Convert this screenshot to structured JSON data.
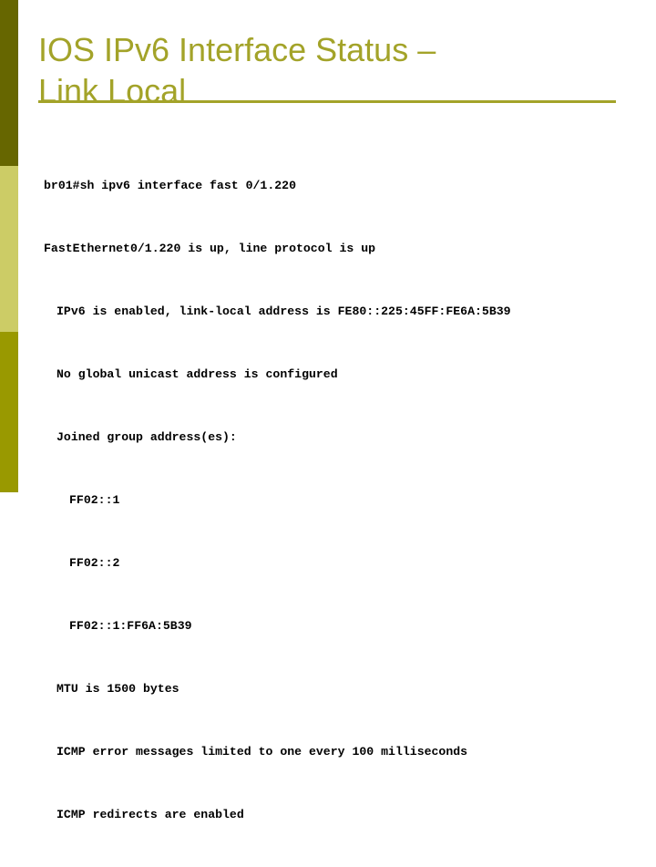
{
  "slide": {
    "title": "IOS IPv6 Interface Status – Link Local",
    "title_line1": "IOS IPv6 Interface Status –",
    "title_line2": "Link Local",
    "accent_color": "#a3a329",
    "sidebar": {
      "band_top_color": "#666600",
      "band_mid_color": "#cccc66",
      "band_bottom_color": "#999900"
    }
  },
  "console": {
    "lines": [
      {
        "text": "br01#sh ipv6 interface fast 0/1.220",
        "indent": 0
      },
      {
        "text": "FastEthernet0/1.220 is up, line protocol is up",
        "indent": 0
      },
      {
        "text": "IPv6 is enabled, link-local address is FE80::225:45FF:FE6A:5B39",
        "indent": 1
      },
      {
        "text": "No global unicast address is configured",
        "indent": 1
      },
      {
        "text": "Joined group address(es):",
        "indent": 1
      },
      {
        "text": "FF02::1",
        "indent": 2
      },
      {
        "text": "FF02::2",
        "indent": 2
      },
      {
        "text": "FF02::1:FF6A:5B39",
        "indent": 2
      },
      {
        "text": "MTU is 1500 bytes",
        "indent": 1
      },
      {
        "text": "ICMP error messages limited to one every 100 milliseconds",
        "indent": 1
      },
      {
        "text": "ICMP redirects are enabled",
        "indent": 1
      }
    ]
  }
}
